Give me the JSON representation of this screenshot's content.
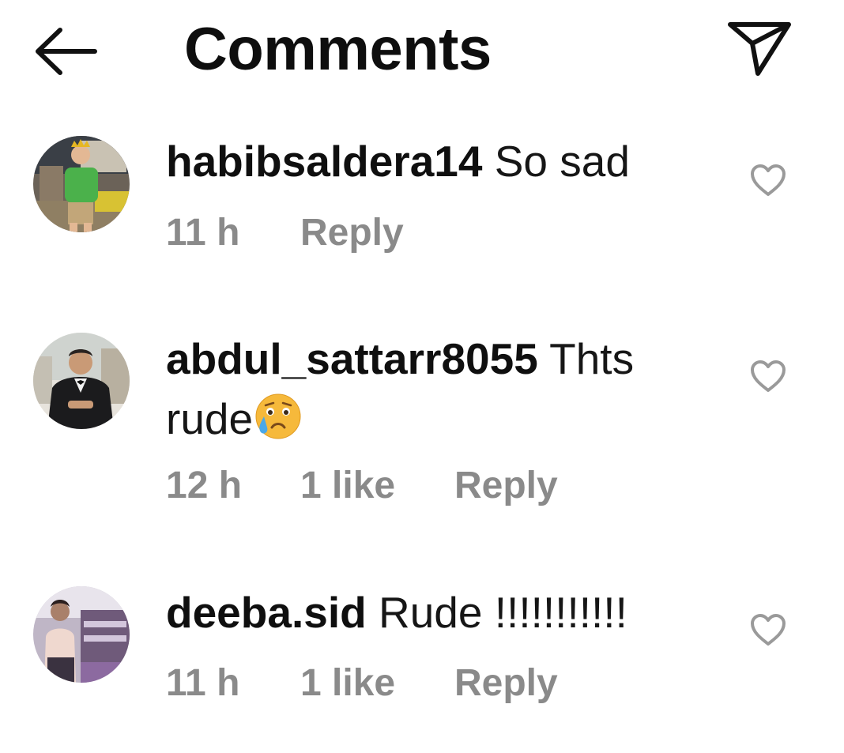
{
  "header": {
    "title": "Comments",
    "back_icon": "arrow-left-icon",
    "share_icon": "paper-plane-icon"
  },
  "comments": [
    {
      "username": "habibsaldera14",
      "text": "So sad",
      "time": "11 h",
      "likes": "",
      "reply_label": "Reply",
      "avatar": "child-in-crown-photo"
    },
    {
      "username": "abdul_sattarr8055",
      "text": "Thts rude",
      "emoji": "crying-face",
      "time": "12 h",
      "likes": "1 like",
      "reply_label": "Reply",
      "avatar": "man-in-tuxedo-photo"
    },
    {
      "username": "deeba.sid",
      "text": "Rude !!!!!!!!!!!",
      "time": "11 h",
      "likes": "1 like",
      "reply_label": "Reply",
      "avatar": "woman-at-market-photo"
    }
  ],
  "colors": {
    "text": "#111111",
    "meta": "#8a8a8a",
    "icon": "#111111",
    "heart": "#9a9a9a"
  }
}
